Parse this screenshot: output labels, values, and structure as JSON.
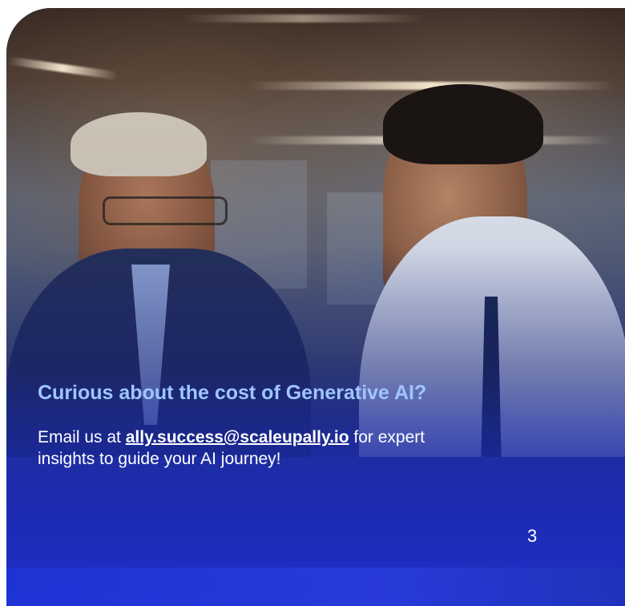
{
  "slide": {
    "headline": "Curious about the cost of Generative AI?",
    "body_prefix": "Email us at ",
    "email": "ally.success@scaleupally.io",
    "body_suffix": " for expert insights to guide your AI journey!",
    "page_number": "3"
  },
  "photo": {
    "description_icon": "office-meeting-photo"
  },
  "colors": {
    "headline": "#9fc6ff",
    "body": "#ffffff",
    "overlay_blue": "#1f2fb0"
  }
}
